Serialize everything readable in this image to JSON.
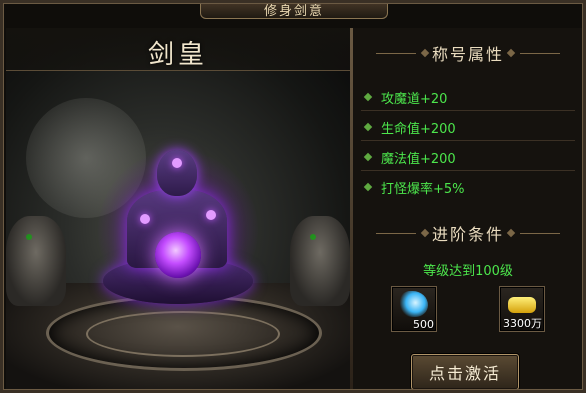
{
  "window": {
    "title": "修身剑意"
  },
  "scene": {
    "name": "剑皇"
  },
  "attributes": {
    "heading": "称号属性",
    "items": [
      "攻魔道+20",
      "生命值+200",
      "魔法值+200",
      "打怪爆率+5%"
    ]
  },
  "advance": {
    "heading": "进阶条件",
    "requirement": "等级达到100级",
    "costs": [
      {
        "icon": "crystal-icon",
        "quantity": "500"
      },
      {
        "icon": "gold-ingot-icon",
        "quantity": "3300万"
      }
    ],
    "button_label": "点击激活"
  },
  "colors": {
    "attribute_text": "#4ce64c",
    "accent_purple": "#c44dff",
    "frame_gold": "#8a7552"
  }
}
